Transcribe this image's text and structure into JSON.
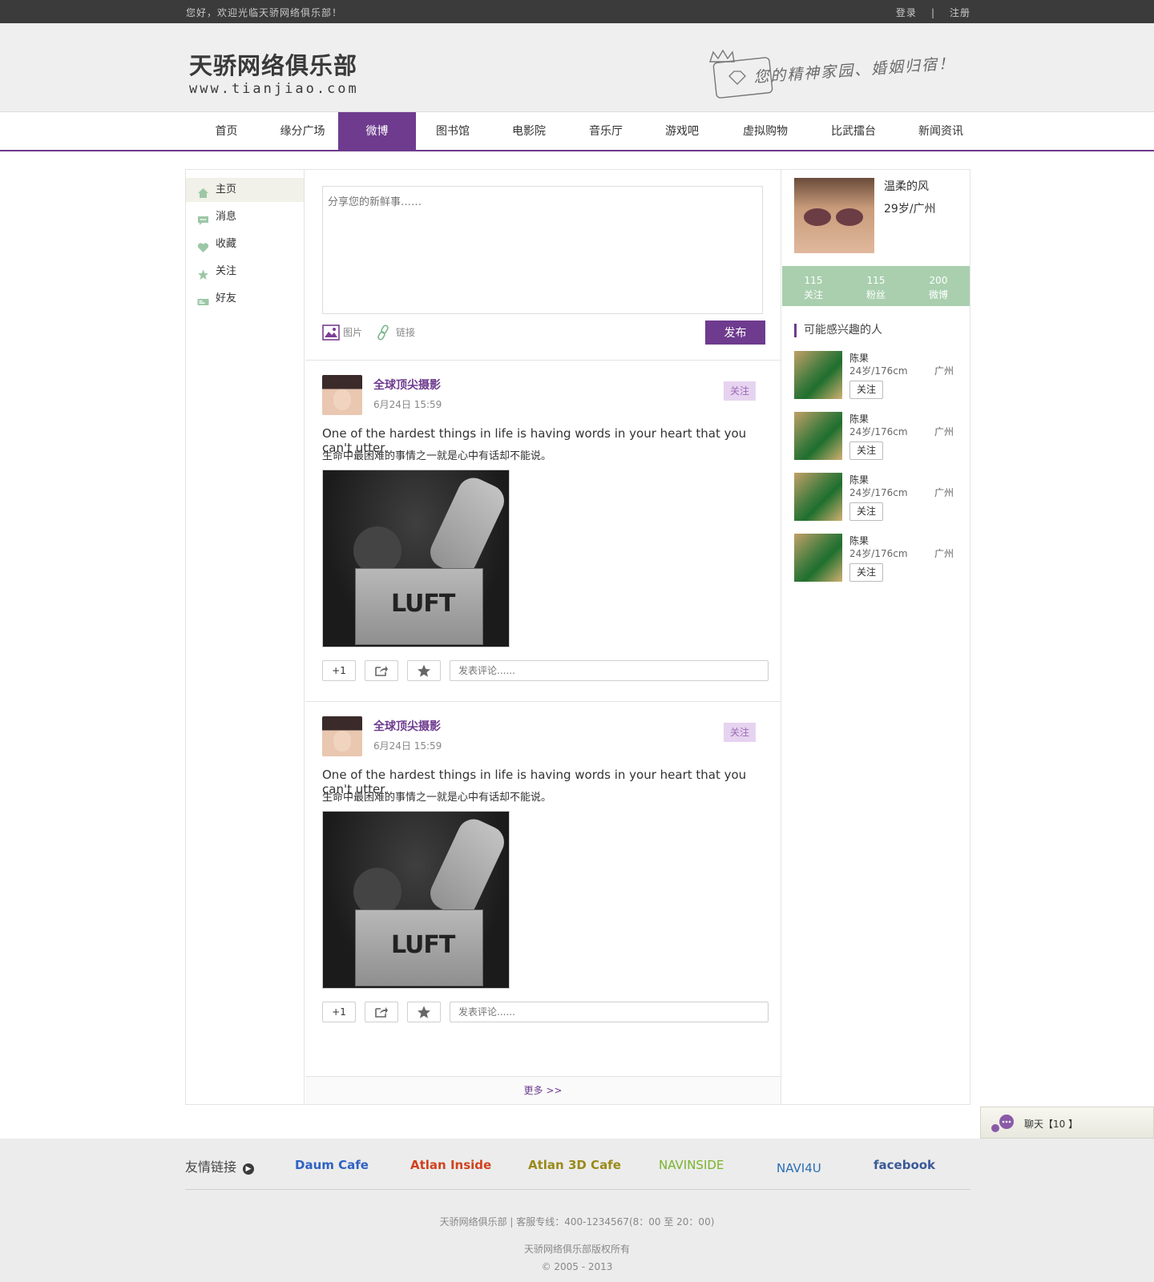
{
  "topbar": {
    "greeting": "您好，欢迎光临天骄网络俱乐部！",
    "login": "登录",
    "separator": "|",
    "register": "注册"
  },
  "header": {
    "logo_cn": "天骄网络俱乐部",
    "logo_en": "www.tianjiao.com",
    "slogan": "您的精神家园、婚姻归宿！"
  },
  "nav": {
    "items": [
      {
        "label": "首页",
        "active": false
      },
      {
        "label": "缘分广场",
        "active": false
      },
      {
        "label": "微博",
        "active": true
      },
      {
        "label": "图书馆",
        "active": false
      },
      {
        "label": "电影院",
        "active": false
      },
      {
        "label": "音乐厅",
        "active": false
      },
      {
        "label": "游戏吧",
        "active": false
      },
      {
        "label": "虚拟购物",
        "active": false
      },
      {
        "label": "比武擂台",
        "active": false
      },
      {
        "label": "新闻资讯",
        "active": false
      }
    ],
    "active_color": "#6e3b8e"
  },
  "sidebar": {
    "items": [
      {
        "label": "主页",
        "icon": "home-icon"
      },
      {
        "label": "消息",
        "icon": "message-icon"
      },
      {
        "label": "收藏",
        "icon": "heart-icon"
      },
      {
        "label": "关注",
        "icon": "star-icon"
      },
      {
        "label": "好友",
        "icon": "friends-icon"
      }
    ]
  },
  "composer": {
    "placeholder": "分享您的新鲜事……",
    "image_label": "图片",
    "link_label": "链接",
    "publish_label": "发布"
  },
  "posts": [
    {
      "author": "全球顶尖摄影",
      "time": "6月24日 15:59",
      "follow": "关注",
      "text_en": "One of the hardest things in life is having words in your heart that you can't utter.",
      "text_cn": "生命中最困难的事情之一就是心中有话却不能说。",
      "photo_label": "LUFT",
      "plus_one": "+1",
      "comment_placeholder": "发表评论......"
    },
    {
      "author": "全球顶尖摄影",
      "time": "6月24日 15:59",
      "follow": "关注",
      "text_en": "One of the hardest things in life is having words in your heart that you can't utter.",
      "text_cn": "生命中最困难的事情之一就是心中有话却不能说。",
      "photo_label": "LUFT",
      "plus_one": "+1",
      "comment_placeholder": "发表评论......"
    }
  ],
  "more": "更多 >>",
  "profile": {
    "name": "温柔的风",
    "info": "29岁/广州",
    "stats": [
      {
        "value": "115",
        "label": "关注"
      },
      {
        "value": "115",
        "label": "粉丝"
      },
      {
        "value": "200",
        "label": "微博"
      }
    ],
    "stats_color": "#a9cfae"
  },
  "suggest": {
    "title": "可能感兴趣的人",
    "people": [
      {
        "name": "陈果",
        "age": "24岁/176cm",
        "city": "广州",
        "follow": "关注"
      },
      {
        "name": "陈果",
        "age": "24岁/176cm",
        "city": "广州",
        "follow": "关注"
      },
      {
        "name": "陈果",
        "age": "24岁/176cm",
        "city": "广州",
        "follow": "关注"
      },
      {
        "name": "陈果",
        "age": "24岁/176cm",
        "city": "广州",
        "follow": "关注"
      }
    ]
  },
  "chat": {
    "label": "聊天【10 】"
  },
  "footer": {
    "links_title": "友情链接",
    "partners": [
      {
        "name": "Daum Cafe",
        "color": "#2f62c4"
      },
      {
        "name": "Atlan Inside",
        "color": "#d1431e"
      },
      {
        "name": "Atlan 3D Cafe",
        "color": "#9a8a1a"
      },
      {
        "name": "NAVINSIDE",
        "color": "#7ab32b"
      },
      {
        "name": "NAVI4U",
        "color": "#2a6fb5"
      },
      {
        "name": "facebook",
        "color": "#3b5998"
      }
    ],
    "line1": "天骄网络俱乐部  |   客服专线：400-1234567(8：00 至 20：00)",
    "line2": "天骄网络俱乐部版权所有",
    "line3": "© 2005 - 2013"
  }
}
